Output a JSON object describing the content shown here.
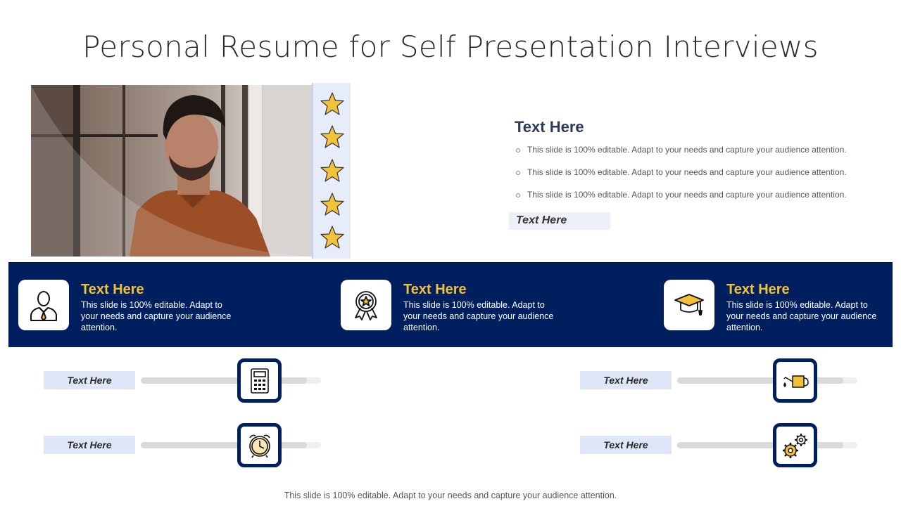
{
  "title": "Personal Resume for Self Presentation Interviews",
  "rating_stars": 5,
  "profile": {
    "heading": "Text Here",
    "bullets": [
      "This slide is 100% editable. Adapt to your needs and capture your audience attention.",
      "This slide is 100% editable. Adapt to your needs and capture your audience attention.",
      "This slide is 100% editable. Adapt to your needs and capture your audience attention."
    ],
    "tag": "Text Here"
  },
  "cards": [
    {
      "icon": "businessman-icon",
      "title": "Text Here",
      "text": "This slide is 100% editable. Adapt to your needs and capture your audience attention."
    },
    {
      "icon": "award-badge-icon",
      "title": "Text Here",
      "text": "This slide is 100% editable. Adapt to your needs and capture your audience attention."
    },
    {
      "icon": "graduation-cap-icon",
      "title": "Text Here",
      "text": "This slide is 100% editable. Adapt to your needs and capture your audience attention."
    }
  ],
  "skills": [
    {
      "label": "Text Here",
      "icon": "calculator-icon",
      "level": 0.92
    },
    {
      "label": "Text Here",
      "icon": "alarm-clock-icon",
      "level": 0.92
    },
    {
      "label": "Text Here",
      "icon": "watering-can-icon",
      "level": 0.92
    },
    {
      "label": "Text Here",
      "icon": "gears-icon",
      "level": 0.92
    }
  ],
  "footer": "This slide is 100% editable. Adapt to your needs and capture your audience attention.",
  "colors": {
    "navy": "#001f5e",
    "gold": "#f2c23b",
    "light_blue": "#dfe6f8"
  }
}
